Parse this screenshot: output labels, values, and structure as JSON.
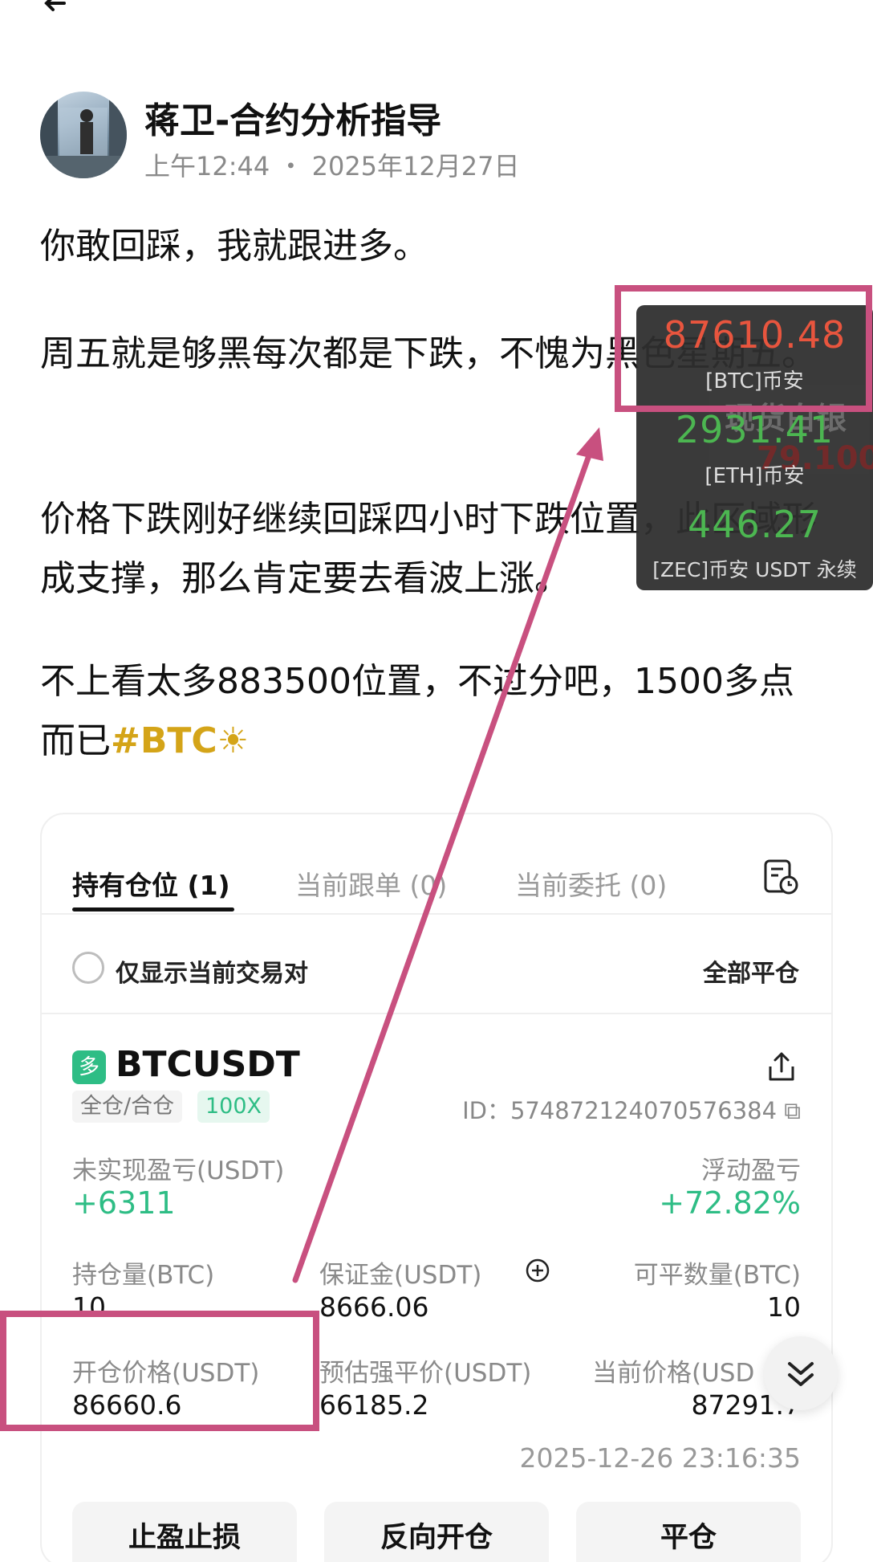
{
  "author": {
    "name": "蒋卫-合约分析指导",
    "time": "上午12:44",
    "separator": "・",
    "date": "2025年12月27日"
  },
  "post": {
    "p1": "你敢回踩，我就跟进多。",
    "p2": "周五就是够黑每次都是下跌，不愧为黑色星期五。",
    "p3": "价格下跌刚好继续回踩四小时下跌位置，此区域形成支撑，那么肯定要去看波上涨。",
    "p4": "不上看太多883500位置，不过分吧，1500多点而已",
    "hashtag": "#BTC☀"
  },
  "tabs": [
    {
      "label": "持有仓位 (1)"
    },
    {
      "label": "当前跟单 (0)"
    },
    {
      "label": "当前委托 (0)"
    }
  ],
  "filter": {
    "label": "仅显示当前交易对",
    "close_all": "全部平仓"
  },
  "position": {
    "side_badge": "多",
    "symbol": "BTCUSDT",
    "margin_mode": "全仓/合仓",
    "leverage": "100X",
    "id": "ID：574872124070576384",
    "unrealized_label": "未实现盈亏(USDT)",
    "unrealized_value": "+6311",
    "roe_label": "浮动盈亏",
    "roe_value": "+72.82%",
    "size_label": "持仓量(BTC)",
    "size_value": "10",
    "margin_label": "保证金(USDT)",
    "margin_value": "8666.06",
    "closable_label": "可平数量(BTC)",
    "closable_value": "10",
    "entry_label": "开仓价格(USDT)",
    "entry_value": "86660.6",
    "liq_label": "预估强平价(USDT)",
    "liq_value": "66185.2",
    "mark_label": "当前价格(USD",
    "mark_value": "87291.7",
    "timestamp": "2025-12-26 23:16:35"
  },
  "actions": {
    "tpsl": "止盈止损",
    "reverse": "反向开仓",
    "close": "平仓"
  },
  "ticker": [
    {
      "price": "87610.48",
      "name": "[BTC]币安",
      "color": "#e8553e"
    },
    {
      "price": "2931.41",
      "name": "[ETH]币安",
      "color": "#4cb651"
    },
    {
      "price": "446.27",
      "name": "[ZEC]币安 USDT 永续",
      "color": "#4cb651"
    }
  ],
  "ticker_ghost": {
    "text": "现货白银",
    "value": "79.100"
  },
  "colors": {
    "annotation": "#c8507f",
    "long_green": "#2ebd85",
    "hashtag_gold": "#d4a418"
  }
}
